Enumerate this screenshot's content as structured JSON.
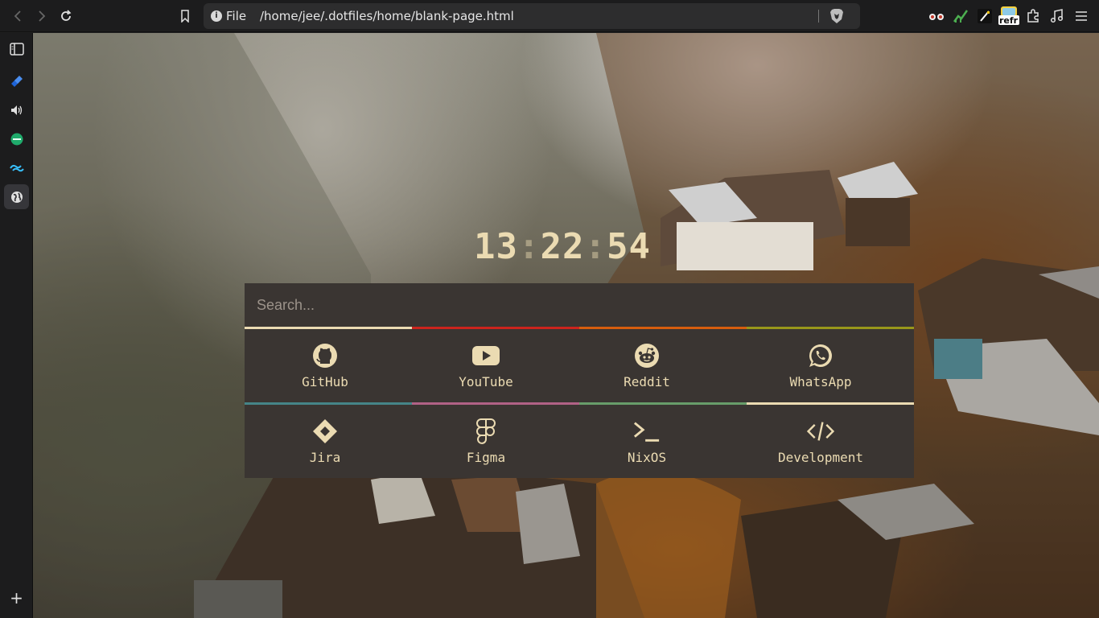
{
  "browser": {
    "url_scheme": "File",
    "url_path": "/home/jee/.dotfiles/home/blank-page.html",
    "extensions": [
      "reader-glasses-icon",
      "chart-icon",
      "slash-icon",
      "refr-icon",
      "puzzle-icon",
      "music-icon",
      "menu-icon"
    ],
    "refr_label": "refr"
  },
  "sidebar": {
    "items": [
      "sidebar-toggle-icon",
      "jira-icon",
      "speaker-icon",
      "phone-app-icon",
      "tailwind-icon",
      "globe-icon"
    ],
    "add_label": "+"
  },
  "clock": {
    "hours": "13",
    "minutes": "22",
    "seconds": "54",
    "separator": ":"
  },
  "search": {
    "placeholder": "Search..."
  },
  "stripes": {
    "top": [
      "#ebdbb2",
      "#cc241d",
      "#d65d0e",
      "#98971a"
    ],
    "middle": [
      "#458588",
      "#b16286",
      "#689d6a",
      "#ebdbb2"
    ]
  },
  "links": {
    "row1": [
      {
        "label": "GitHub",
        "icon": "github-icon"
      },
      {
        "label": "YouTube",
        "icon": "youtube-icon"
      },
      {
        "label": "Reddit",
        "icon": "reddit-icon"
      },
      {
        "label": "WhatsApp",
        "icon": "whatsapp-icon"
      }
    ],
    "row2": [
      {
        "label": "Jira",
        "icon": "jira-diamond-icon"
      },
      {
        "label": "Figma",
        "icon": "figma-icon"
      },
      {
        "label": "NixOS",
        "icon": "terminal-icon"
      },
      {
        "label": "Development",
        "icon": "code-icon"
      }
    ]
  },
  "colors": {
    "card_bg": "#3a3532",
    "text": "#ebdbb2"
  }
}
